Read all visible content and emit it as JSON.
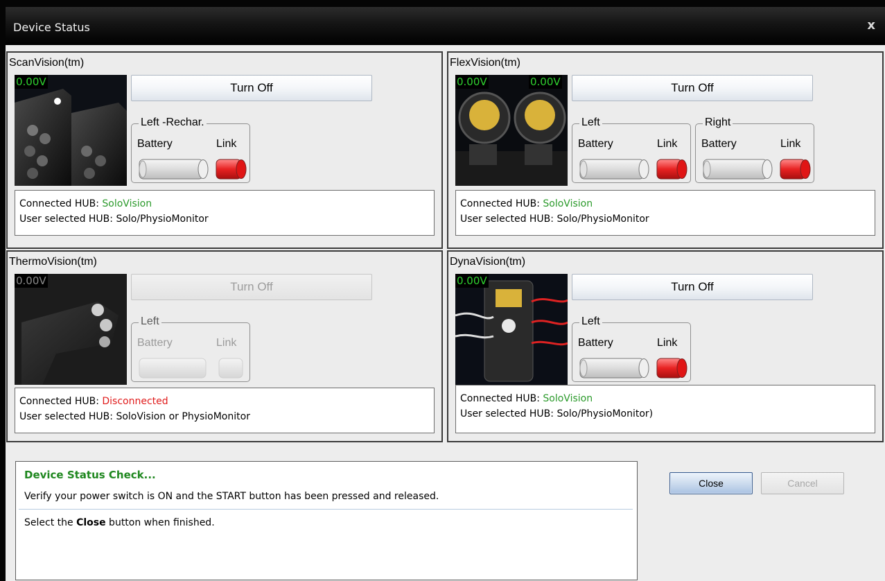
{
  "window": {
    "title": "Device Status",
    "close_glyph": "x"
  },
  "devices": [
    {
      "name": "ScanVision(tm)",
      "volt_left": "0.00V",
      "turn_off": "Turn Off",
      "groups": [
        {
          "legend": "Left -Rechar.",
          "battery": "Battery",
          "link": "Link"
        }
      ],
      "hub_label": "Connected HUB:",
      "hub_value": "SoloVision",
      "user_label": "User selected HUB:",
      "user_value": "Solo/PhysioMonitor"
    },
    {
      "name": "FlexVision(tm)",
      "volt_left": "0.00V",
      "volt_right": "0.00V",
      "turn_off": "Turn Off",
      "groups": [
        {
          "legend": "Left",
          "battery": "Battery",
          "link": "Link"
        },
        {
          "legend": "Right",
          "battery": "Battery",
          "link": "Link"
        }
      ],
      "hub_label": "Connected HUB:",
      "hub_value": "SoloVision",
      "user_label": "User selected HUB:",
      "user_value": "Solo/PhysioMonitor"
    },
    {
      "name": "ThermoVision(tm)",
      "volt_left": "0.00V",
      "turn_off": "Turn Off",
      "groups": [
        {
          "legend": "Left",
          "battery": "Battery",
          "link": "Link"
        }
      ],
      "hub_label": "Connected HUB:",
      "hub_value": "Disconnected",
      "user_label": "User selected HUB:",
      "user_value": "SoloVision or PhysioMonitor"
    },
    {
      "name": "DynaVision(tm)",
      "volt_left": "0.00V",
      "turn_off": "Turn Off",
      "groups": [
        {
          "legend": "Left",
          "battery": "Battery",
          "link": "Link"
        }
      ],
      "hub_label": "Connected HUB:",
      "hub_value": "SoloVision",
      "user_label": "User selected HUB:",
      "user_value": "Solo/PhysioMonitor)"
    }
  ],
  "message": {
    "title": "Device Status Check...",
    "line1": "Verify your power switch is ON and the START button has been pressed and released.",
    "line2_prefix": "Select the ",
    "line2_bold": "Close",
    "line2_suffix": " button when finished."
  },
  "buttons": {
    "close": "Close",
    "cancel": "Cancel"
  },
  "colors": {
    "hub_ok": "#2b9a2b",
    "hub_disconnected": "#e01b1b",
    "status_title": "#208820",
    "voltage": "#2fd12f",
    "link_active": "#e02020"
  }
}
